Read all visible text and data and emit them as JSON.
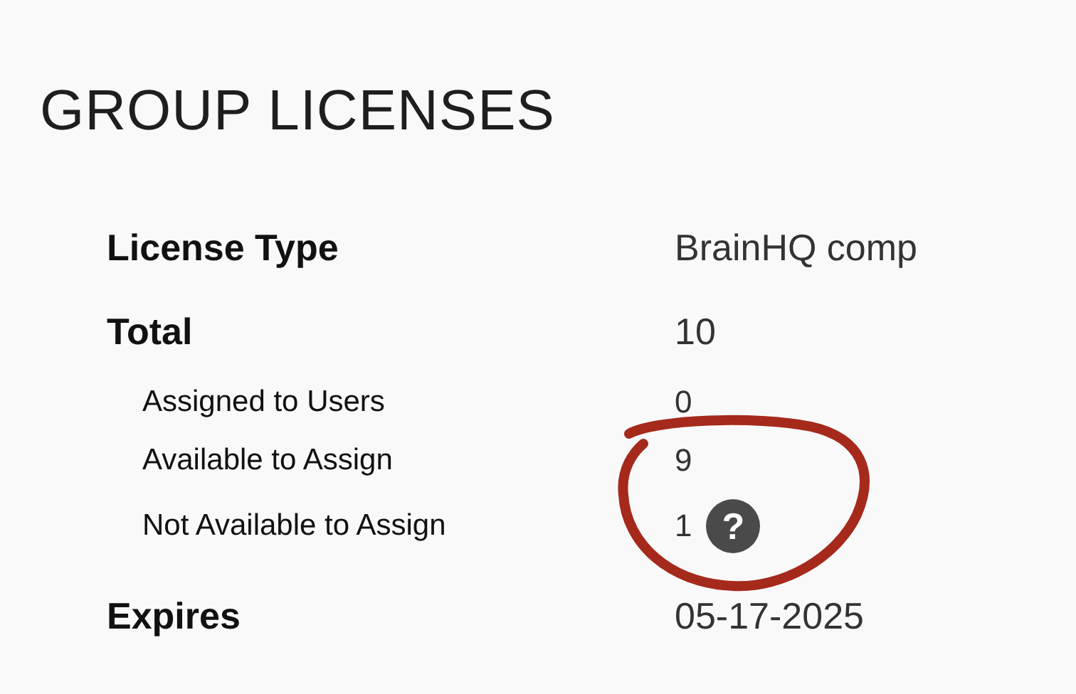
{
  "title": "GROUP LICENSES",
  "rows": [
    {
      "kind": "main",
      "label": "License Type",
      "value": "BrainHQ comp"
    },
    {
      "kind": "main",
      "label": "Total",
      "value": "10"
    },
    {
      "kind": "sub",
      "label": "Assigned to Users",
      "value": "0"
    },
    {
      "kind": "sub",
      "label": "Available to Assign",
      "value": "9"
    },
    {
      "kind": "sub",
      "label": "Not Available to Assign",
      "value": "1",
      "help": "?"
    },
    {
      "kind": "main",
      "label": "Expires",
      "value": "05-17-2025"
    }
  ],
  "annotation": {
    "kind": "circle",
    "color": "#a52a1c"
  }
}
